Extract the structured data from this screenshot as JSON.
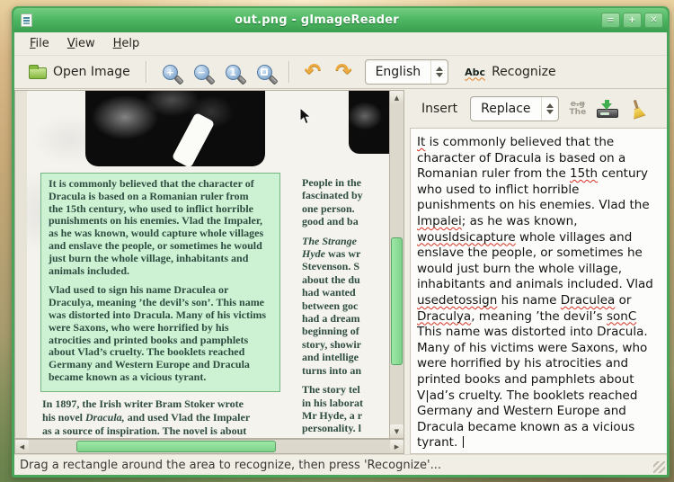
{
  "window": {
    "title": "out.png - gImageReader"
  },
  "menu": {
    "file": "File",
    "view": "View",
    "help": "Help"
  },
  "toolbar": {
    "open_image": "Open Image",
    "zoom_in": "+",
    "zoom_out": "−",
    "zoom_original": "1",
    "rotate_left": "↶",
    "rotate_right": "↷",
    "language": "English",
    "abc": "Abc",
    "recognize": "Recognize"
  },
  "ocr_panel": {
    "insert": "Insert",
    "mode": "Replace",
    "sub_icon_top": "e.g",
    "sub_icon_bottom": "The",
    "segments": [
      {
        "t": "It",
        "err": true
      },
      {
        "t": " is commonly believed that the character of Dracula is based on a Romanian ruler from the "
      },
      {
        "t": "15th",
        "err": true
      },
      {
        "t": " century who used to inflict horrible punishments on his enemies. Vlad the "
      },
      {
        "t": "Impalei",
        "err": true
      },
      {
        "t": "; as he was known, "
      },
      {
        "t": "wousldsicapture",
        "err": true
      },
      {
        "t": " whole villages and enslave the people, or sometimes he would just burn the whole village, inhabitants and animals included. Vlad "
      },
      {
        "t": "usedetossign",
        "err": true
      },
      {
        "t": " his name "
      },
      {
        "t": "Draculea",
        "err": true
      },
      {
        "t": " or "
      },
      {
        "t": "Draculya",
        "err": true
      },
      {
        "t": ", meaning ’the devil’s "
      },
      {
        "t": "sonC",
        "err": true
      },
      {
        "t": " This name was distorted into Dracula. Many of his victims were Saxons, who were horrified by his atrocities and printed books and pamphlets about V|ad’s cruelty. The booklets reached Germany and Western Europe and Dracula became known as a vicious tyrant. "
      }
    ]
  },
  "scan": {
    "highlight_p1": [
      "It is commonly believed that the character of",
      "Dracula is based on a Romanian ruler from",
      "the 15th century, who used to inflict horrible",
      "punishments on his enemies. Vlad the Impaler,",
      "as he was known, would capture whole villages",
      "and enslave the people, or sometimes he would",
      "just burn the whole village, inhabitants and",
      "animals included."
    ],
    "highlight_p2": [
      "Vlad used to sign his name Draculea or",
      "Draculya, meaning ’the devil’s son’. This name",
      "was distorted into Dracula. Many of his victims",
      "were Saxons, who were horrified by his",
      "atrocities and printed books and pamphlets",
      "about Vlad’s cruelty. The booklets reached",
      "Germany and Western Europe and Dracula",
      "became known as a vicious tyrant."
    ],
    "below": [
      [
        "In 1897, the Irish writer Bram Stoker wrote"
      ],
      [
        "his novel ",
        {
          "t": "Dracula,",
          "em": true
        },
        " and used Vlad the Impaler"
      ],
      [
        "as a source of inspiration. The novel is about"
      ]
    ],
    "col2": [
      [
        "People in the"
      ],
      [
        "fascinated by"
      ],
      [
        "one person."
      ],
      [
        "good and ba"
      ],
      "gap",
      [
        {
          "t": "The Strange",
          "em": true
        }
      ],
      [
        {
          "t": "Hyde",
          "em": true
        },
        " was wr"
      ],
      [
        "Stevenson. S"
      ],
      [
        "about the du"
      ],
      [
        "had wanted"
      ],
      [
        "between goc"
      ],
      [
        "had a dream"
      ],
      [
        "beginning of"
      ],
      [
        "story, showir"
      ],
      [
        "and intellige"
      ],
      [
        "turns into an"
      ],
      "gap",
      [
        "The story tel"
      ],
      [
        "in his laborat"
      ],
      [
        "Mr Hyde, a r"
      ],
      [
        "personality. l"
      ]
    ]
  },
  "statusbar": {
    "text": "Drag a rectangle around the area to recognize, then press 'Recognize'..."
  },
  "colors": {
    "titlebar_green": "#4fb863",
    "window_border": "#4aa55a",
    "selection_green": "#cdf2d3",
    "scroll_thumb": "#8fe098",
    "squiggle_red": "#d93025",
    "zoom_icon_blue": "#9dbcdc",
    "rotate_icon_orange": "#ecaa41"
  }
}
